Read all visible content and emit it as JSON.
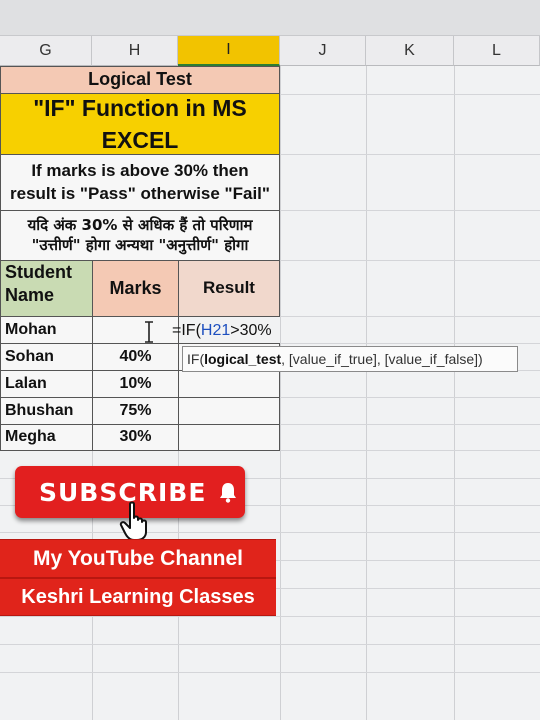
{
  "columns": [
    "G",
    "H",
    "I",
    "J",
    "K",
    "L"
  ],
  "sheet": {
    "title": "Logical Test",
    "heading_line1": "\"IF\" Function in MS",
    "heading_line2": "EXCEL",
    "desc_en_line1": "If marks is above 30% then",
    "desc_en_line2": "result is \"Pass\" otherwise \"Fail\"",
    "desc_hi_line1": "यदि अंक 30% से अधिक हैं तो परिणाम",
    "desc_hi_line2": "\"उत्तीर्ण\" होगा अन्यथा \"अनुत्तीर्ण\" होगा",
    "headers": {
      "name_line1": "Student",
      "name_line2": "Name",
      "marks": "Marks",
      "result": "Result"
    },
    "rows": [
      {
        "name": "Mohan",
        "marks": ""
      },
      {
        "name": "Sohan",
        "marks": "40%"
      },
      {
        "name": "Lalan",
        "marks": "10%"
      },
      {
        "name": "Bhushan",
        "marks": "75%"
      },
      {
        "name": "Megha",
        "marks": "30%"
      }
    ]
  },
  "formula": {
    "prefix": "=IF(",
    "ref": "H21",
    "suffix": ">30%"
  },
  "tooltip": {
    "fn": "IF(",
    "arg1": "logical_test",
    "rest": ", [value_if_true], [value_if_false])"
  },
  "overlay": {
    "subscribe": "SUBSCRIBE",
    "channel_line1": "My YouTube Channel",
    "channel_line2": "Keshri Learning Classes"
  },
  "colors": {
    "accent_yellow": "#f7d000",
    "peach": "#f4c9b4",
    "green": "#c9dbb3",
    "subscribe_red": "#e21f1f",
    "ref_blue": "#1d4fbf"
  }
}
